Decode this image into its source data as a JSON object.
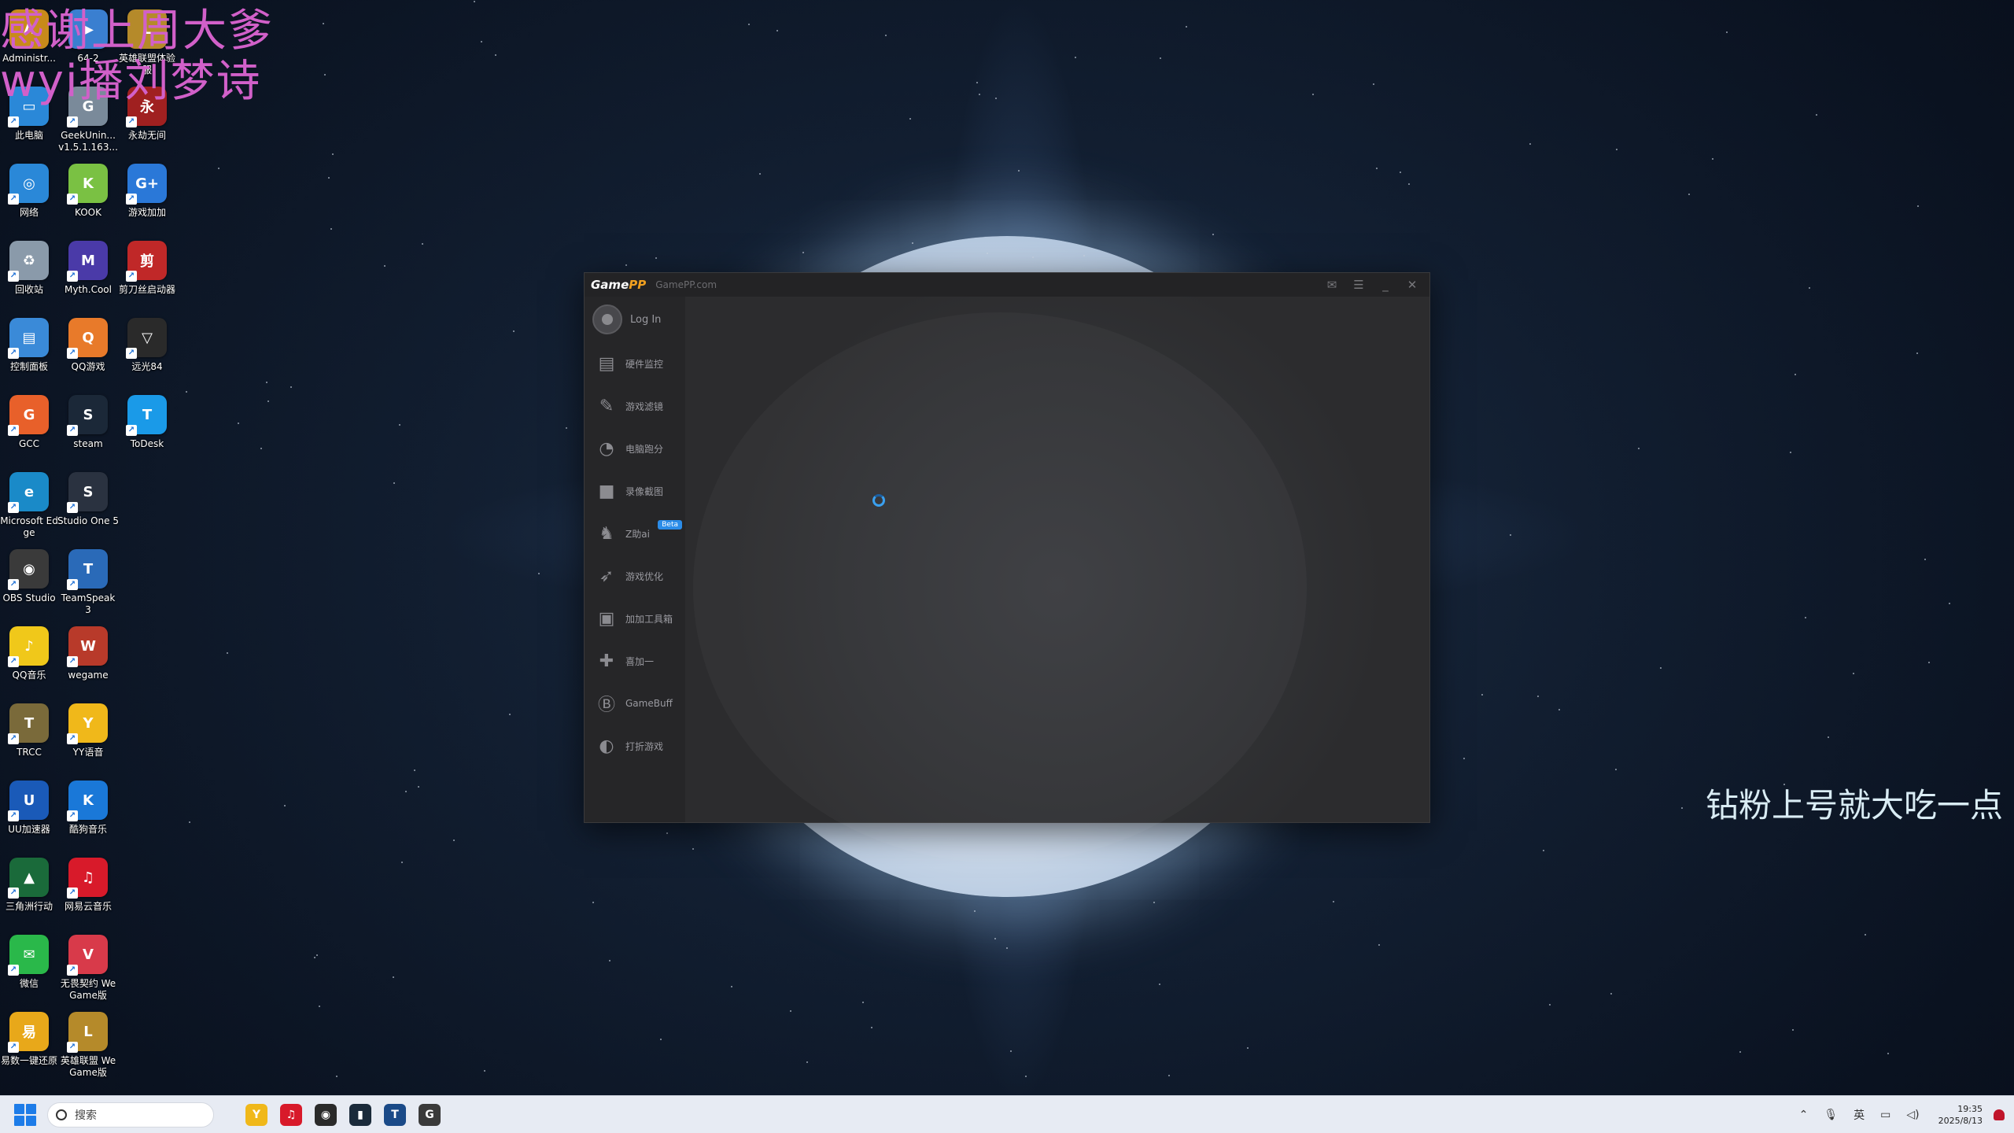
{
  "overlay": {
    "line1": "感谢上周大爹",
    "line2": "wyi播刘梦诗",
    "right_text": "钻粉上号就大吃一点"
  },
  "desktop_icons": [
    {
      "label": "Administr...",
      "color": "#c88a1a",
      "glyph": "A"
    },
    {
      "label": "64-2",
      "color": "#3a7fd0",
      "glyph": "▶"
    },
    {
      "label": "英雄联盟体验服",
      "color": "#b58a2a",
      "glyph": "L"
    },
    {
      "label": "此电脑",
      "color": "#2a88d8",
      "glyph": "▭"
    },
    {
      "label": "GeekUnin... v1.5.1.163...",
      "color": "#7a8a9a",
      "glyph": "G"
    },
    {
      "label": "永劫无间",
      "color": "#a02020",
      "glyph": "永"
    },
    {
      "label": "网络",
      "color": "#2a88d8",
      "glyph": "◎"
    },
    {
      "label": "KOOK",
      "color": "#7ac143",
      "glyph": "K"
    },
    {
      "label": "游戏加加",
      "color": "#2a78d8",
      "glyph": "G+"
    },
    {
      "label": "回收站",
      "color": "#8a9aaa",
      "glyph": "♻"
    },
    {
      "label": "Myth.Cool",
      "color": "#4a3aa8",
      "glyph": "M"
    },
    {
      "label": "剪刀丝启动器",
      "color": "#c02828",
      "glyph": "剪"
    },
    {
      "label": "控制面板",
      "color": "#3a8ad8",
      "glyph": "▤"
    },
    {
      "label": "QQ游戏",
      "color": "#e87a2a",
      "glyph": "Q"
    },
    {
      "label": "远光84",
      "color": "#2a2a2a",
      "glyph": "▽"
    },
    {
      "label": "GCC",
      "color": "#e8602a",
      "glyph": "G"
    },
    {
      "label": "steam",
      "color": "#1b2838",
      "glyph": "S"
    },
    {
      "label": "ToDesk",
      "color": "#1a9ae8",
      "glyph": "T"
    },
    {
      "label": "Microsoft Edge",
      "color": "#1a8ac8",
      "glyph": "e"
    },
    {
      "label": "Studio One 5",
      "color": "#2a3240",
      "glyph": "S"
    },
    {
      "label": "OBS Studio",
      "color": "#3a3a3a",
      "glyph": "◉"
    },
    {
      "label": "TeamSpeak 3",
      "color": "#2a6ab8",
      "glyph": "T"
    },
    {
      "label": "QQ音乐",
      "color": "#f0c81a",
      "glyph": "♪"
    },
    {
      "label": "wegame",
      "color": "#b83a2a",
      "glyph": "W"
    },
    {
      "label": "TRCC",
      "color": "#7a6a3a",
      "glyph": "T"
    },
    {
      "label": "YY语音",
      "color": "#f0b81a",
      "glyph": "Y"
    },
    {
      "label": "UU加速器",
      "color": "#1a5ab8",
      "glyph": "U"
    },
    {
      "label": "酷狗音乐",
      "color": "#1a78d8",
      "glyph": "K"
    },
    {
      "label": "三角洲行动",
      "color": "#1a6a3a",
      "glyph": "▲"
    },
    {
      "label": "网易云音乐",
      "color": "#d81a2a",
      "glyph": "♫"
    },
    {
      "label": "微信",
      "color": "#2ab84a",
      "glyph": "✉"
    },
    {
      "label": "无畏契约 WeGame版",
      "color": "#d83a4a",
      "glyph": "V"
    },
    {
      "label": "易数一键还原",
      "color": "#e8a81a",
      "glyph": "易"
    },
    {
      "label": "英雄联盟 WeGame版",
      "color": "#b58a2a",
      "glyph": "L"
    }
  ],
  "app": {
    "logo_game": "Game",
    "logo_pp": "PP",
    "site": "GamePP.com",
    "login": "Log In",
    "nav": [
      {
        "label": "硬件监控",
        "icon": "hardware-monitor-icon",
        "glyph": "▤"
      },
      {
        "label": "游戏滤镜",
        "icon": "game-filter-icon",
        "glyph": "✎"
      },
      {
        "label": "电脑跑分",
        "icon": "benchmark-icon",
        "glyph": "◔"
      },
      {
        "label": "录像截图",
        "icon": "record-icon",
        "glyph": "■"
      },
      {
        "label": "Z助ai",
        "icon": "ai-assistant-icon",
        "glyph": "♞",
        "badge": "Beta"
      },
      {
        "label": "游戏优化",
        "icon": "rocket-icon",
        "glyph": "➶"
      },
      {
        "label": "加加工具箱",
        "icon": "toolbox-icon",
        "glyph": "▣"
      },
      {
        "label": "喜加一",
        "icon": "gift-icon",
        "glyph": "✚"
      },
      {
        "label": "GameBuff",
        "icon": "gamebuff-icon",
        "glyph": "Ⓑ"
      },
      {
        "label": "打折游戏",
        "icon": "discount-icon",
        "glyph": "◐"
      }
    ]
  },
  "taskbar": {
    "search_placeholder": "搜索",
    "apps": [
      {
        "name": "yy-taskbar",
        "color": "#f0b81a",
        "glyph": "Y"
      },
      {
        "name": "netease-taskbar",
        "color": "#d81a2a",
        "glyph": "♫"
      },
      {
        "name": "obs-taskbar",
        "color": "#2a2a2a",
        "glyph": "◉"
      },
      {
        "name": "terminal-taskbar",
        "color": "#1a2a3a",
        "glyph": "▮"
      },
      {
        "name": "teamspeak-taskbar",
        "color": "#1a4a88",
        "glyph": "T"
      },
      {
        "name": "gamepp-taskbar",
        "color": "#3a3a3a",
        "glyph": "G"
      }
    ],
    "ime": "英",
    "time": "19:35",
    "date": "2025/8/13"
  }
}
